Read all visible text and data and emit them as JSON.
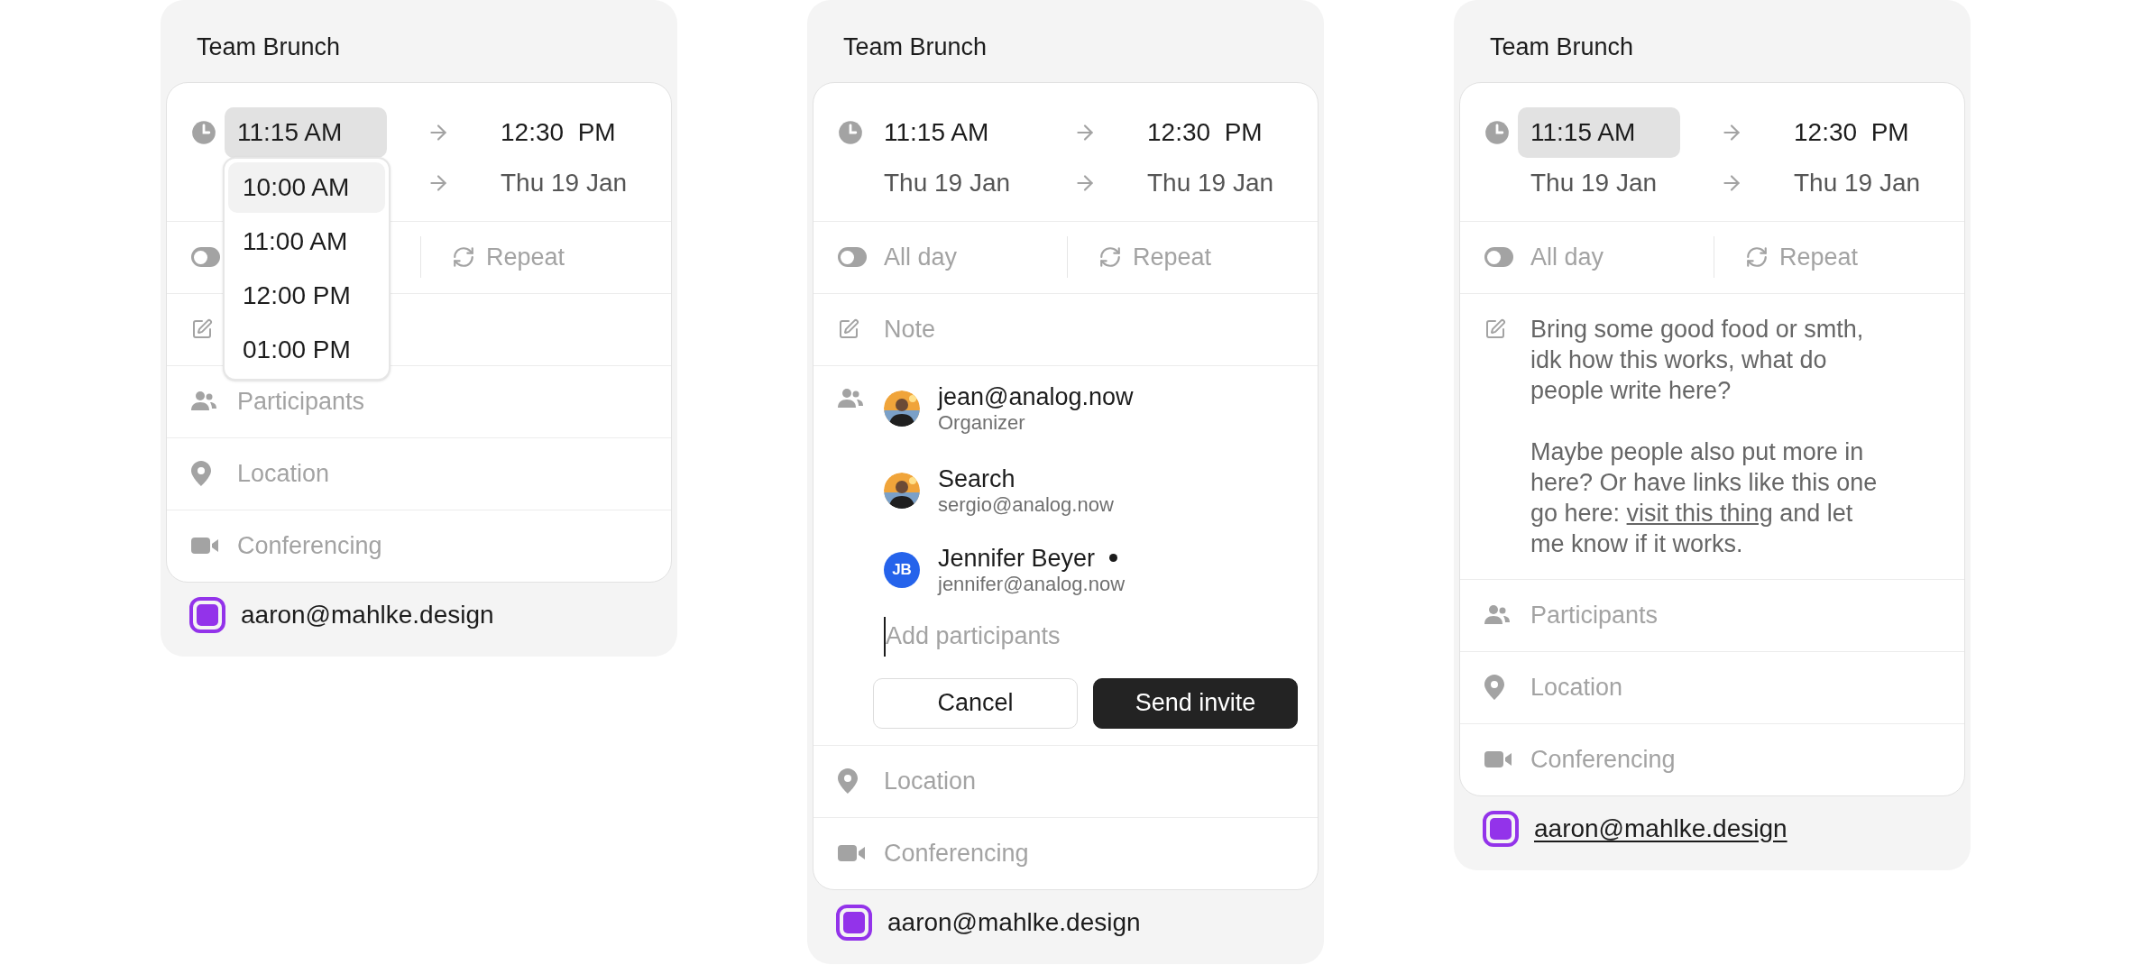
{
  "cards": [
    {
      "title": "Team Brunch",
      "start_time": {
        "text": "11:15 AM",
        "highlighted": true
      },
      "end_time": "12:30  PM",
      "end_date": "Thu 19 Jan",
      "all_day": {
        "on": false
      },
      "repeat": "Repeat",
      "participants": {
        "placeholder": "Participants"
      },
      "location": "Location",
      "conferencing": "Conferencing",
      "account": {
        "email": "aaron@mahlke.design",
        "underlined": false
      },
      "dropdown": [
        {
          "label": "10:00 AM",
          "selected": true
        },
        {
          "label": "11:00 AM",
          "selected": false
        },
        {
          "label": "12:00 PM",
          "selected": false
        },
        {
          "label": "01:00 PM",
          "selected": false
        }
      ]
    },
    {
      "title": "Team Brunch",
      "start_time": {
        "text": "11:15 AM",
        "highlighted": false
      },
      "end_time": "12:30  PM",
      "start_date": "Thu 19 Jan",
      "end_date": "Thu 19 Jan",
      "all_day": {
        "label": "All day",
        "on": false
      },
      "repeat": "Repeat",
      "note": {
        "placeholder": "Note"
      },
      "participants": {
        "people": [
          {
            "name": "jean@analog.now",
            "subtitle": "Organizer",
            "dot": false
          },
          {
            "name": "Search",
            "subtitle": "sergio@analog.now",
            "dot": false
          },
          {
            "name": "Jennifer Beyer",
            "subtitle": "jennifer@analog.now",
            "avatar": {
              "kind": "initials",
              "initials": "JB"
            },
            "dot": true
          }
        ],
        "input_placeholder": "Add participants",
        "buttons": [
          {
            "label": "Cancel",
            "kind": "secondary"
          },
          {
            "label": "Send invite",
            "kind": "primary"
          }
        ]
      },
      "location": "Location",
      "conferencing": "Conferencing",
      "account": {
        "email": "aaron@mahlke.design",
        "underlined": false
      }
    },
    {
      "title": "Team Brunch",
      "start_time": {
        "text": "11:15 AM",
        "highlighted": true
      },
      "end_time": "12:30  PM",
      "start_date": "Thu 19 Jan",
      "end_date": "Thu 19 Jan",
      "all_day": {
        "label": "All day",
        "on": false
      },
      "repeat": "Repeat",
      "note": {
        "paragraphs": [
          {
            "text": "Bring some good food or smth, idk how this works, what do people write here?"
          },
          {
            "text": "Maybe people also put more in here? Or have links like this one go here: ",
            "link": "visit this thing",
            "after": " and let me know if it works."
          }
        ]
      },
      "participants": {
        "placeholder": "Participants"
      },
      "location": "Location",
      "conferencing": "Conferencing",
      "account": {
        "email": "aaron@mahlke.design",
        "underlined": true
      }
    }
  ]
}
